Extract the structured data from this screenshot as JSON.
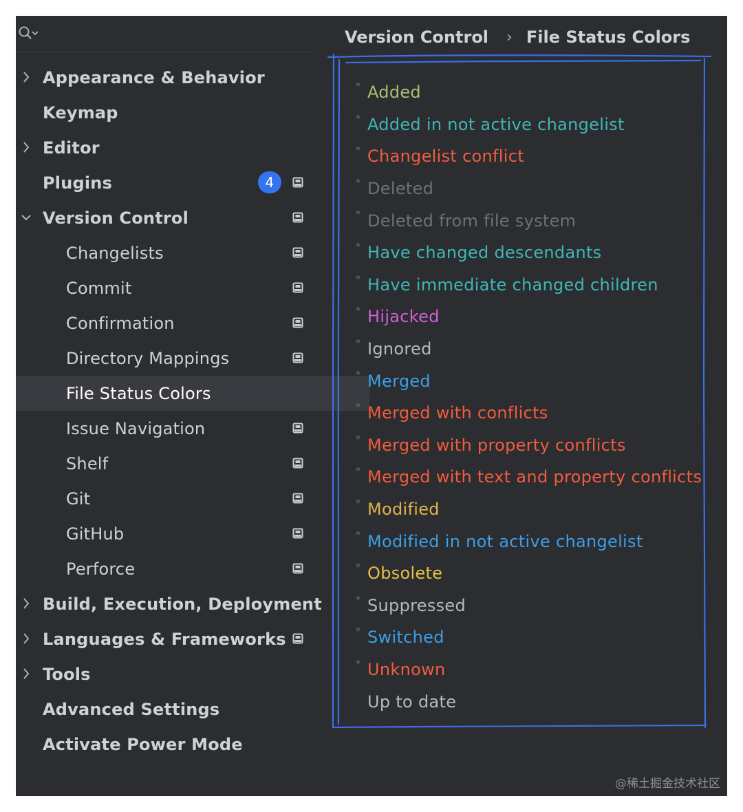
{
  "breadcrumb": {
    "parent": "Version Control",
    "separator": "›",
    "current": "File Status Colors"
  },
  "sidebar": {
    "items": [
      {
        "label": "Appearance & Behavior",
        "level": 0,
        "arrow": "right",
        "project": false
      },
      {
        "label": "Keymap",
        "level": 0,
        "arrow": null,
        "project": false
      },
      {
        "label": "Editor",
        "level": 0,
        "arrow": "right",
        "project": false
      },
      {
        "label": "Plugins",
        "level": 0,
        "arrow": null,
        "project": true,
        "badge": "4"
      },
      {
        "label": "Version Control",
        "level": 0,
        "arrow": "down",
        "project": true
      },
      {
        "label": "Changelists",
        "level": 1,
        "arrow": null,
        "project": true
      },
      {
        "label": "Commit",
        "level": 1,
        "arrow": null,
        "project": true
      },
      {
        "label": "Confirmation",
        "level": 1,
        "arrow": null,
        "project": true
      },
      {
        "label": "Directory Mappings",
        "level": 1,
        "arrow": null,
        "project": true
      },
      {
        "label": "File Status Colors",
        "level": 1,
        "arrow": null,
        "project": false,
        "selected": true
      },
      {
        "label": "Issue Navigation",
        "level": 1,
        "arrow": null,
        "project": true
      },
      {
        "label": "Shelf",
        "level": 1,
        "arrow": null,
        "project": true
      },
      {
        "label": "Git",
        "level": 1,
        "arrow": null,
        "project": true
      },
      {
        "label": "GitHub",
        "level": 1,
        "arrow": null,
        "project": true
      },
      {
        "label": "Perforce",
        "level": 1,
        "arrow": null,
        "project": true
      },
      {
        "label": "Build, Execution, Deployment",
        "level": 0,
        "arrow": "right",
        "project": false
      },
      {
        "label": "Languages & Frameworks",
        "level": 0,
        "arrow": "right",
        "project": true
      },
      {
        "label": "Tools",
        "level": 0,
        "arrow": "right",
        "project": false
      },
      {
        "label": "Advanced Settings",
        "level": 0,
        "arrow": null,
        "project": false
      },
      {
        "label": "Activate Power Mode",
        "level": 0,
        "arrow": null,
        "project": false
      }
    ]
  },
  "statuses": [
    {
      "name": "Added",
      "color": "#a6c26f",
      "modified": true
    },
    {
      "name": "Added in not active changelist",
      "color": "#3fb6b6",
      "modified": true
    },
    {
      "name": "Changelist conflict",
      "color": "#f15c3f",
      "modified": true
    },
    {
      "name": "Deleted",
      "color": "#6d7075",
      "modified": true
    },
    {
      "name": "Deleted from file system",
      "color": "#6d7075",
      "modified": true
    },
    {
      "name": "Have changed descendants",
      "color": "#3fb6b6",
      "modified": true
    },
    {
      "name": "Have immediate changed children",
      "color": "#3fb6b6",
      "modified": true
    },
    {
      "name": "Hijacked",
      "color": "#d35fd3",
      "modified": true
    },
    {
      "name": "Ignored",
      "color": "#b6b8bd",
      "modified": true
    },
    {
      "name": "Merged",
      "color": "#3d9ee6",
      "modified": true
    },
    {
      "name": "Merged with conflicts",
      "color": "#f15c3f",
      "modified": true
    },
    {
      "name": "Merged with property conflicts",
      "color": "#f15c3f",
      "modified": true
    },
    {
      "name": "Merged with text and property conflicts",
      "color": "#f15c3f",
      "modified": true
    },
    {
      "name": "Modified",
      "color": "#e0b44a",
      "modified": true
    },
    {
      "name": "Modified in not active changelist",
      "color": "#3d9ee6",
      "modified": true
    },
    {
      "name": "Obsolete",
      "color": "#e8c046",
      "modified": true
    },
    {
      "name": "Suppressed",
      "color": "#b6b8bd",
      "modified": true
    },
    {
      "name": "Switched",
      "color": "#3d9ee6",
      "modified": true
    },
    {
      "name": "Unknown",
      "color": "#f15c3f",
      "modified": true
    },
    {
      "name": "Up to date",
      "color": "#b6b8bd",
      "modified": false
    }
  ],
  "annotation_color": "#3a6fe8",
  "watermark": "@稀土掘金技术社区"
}
